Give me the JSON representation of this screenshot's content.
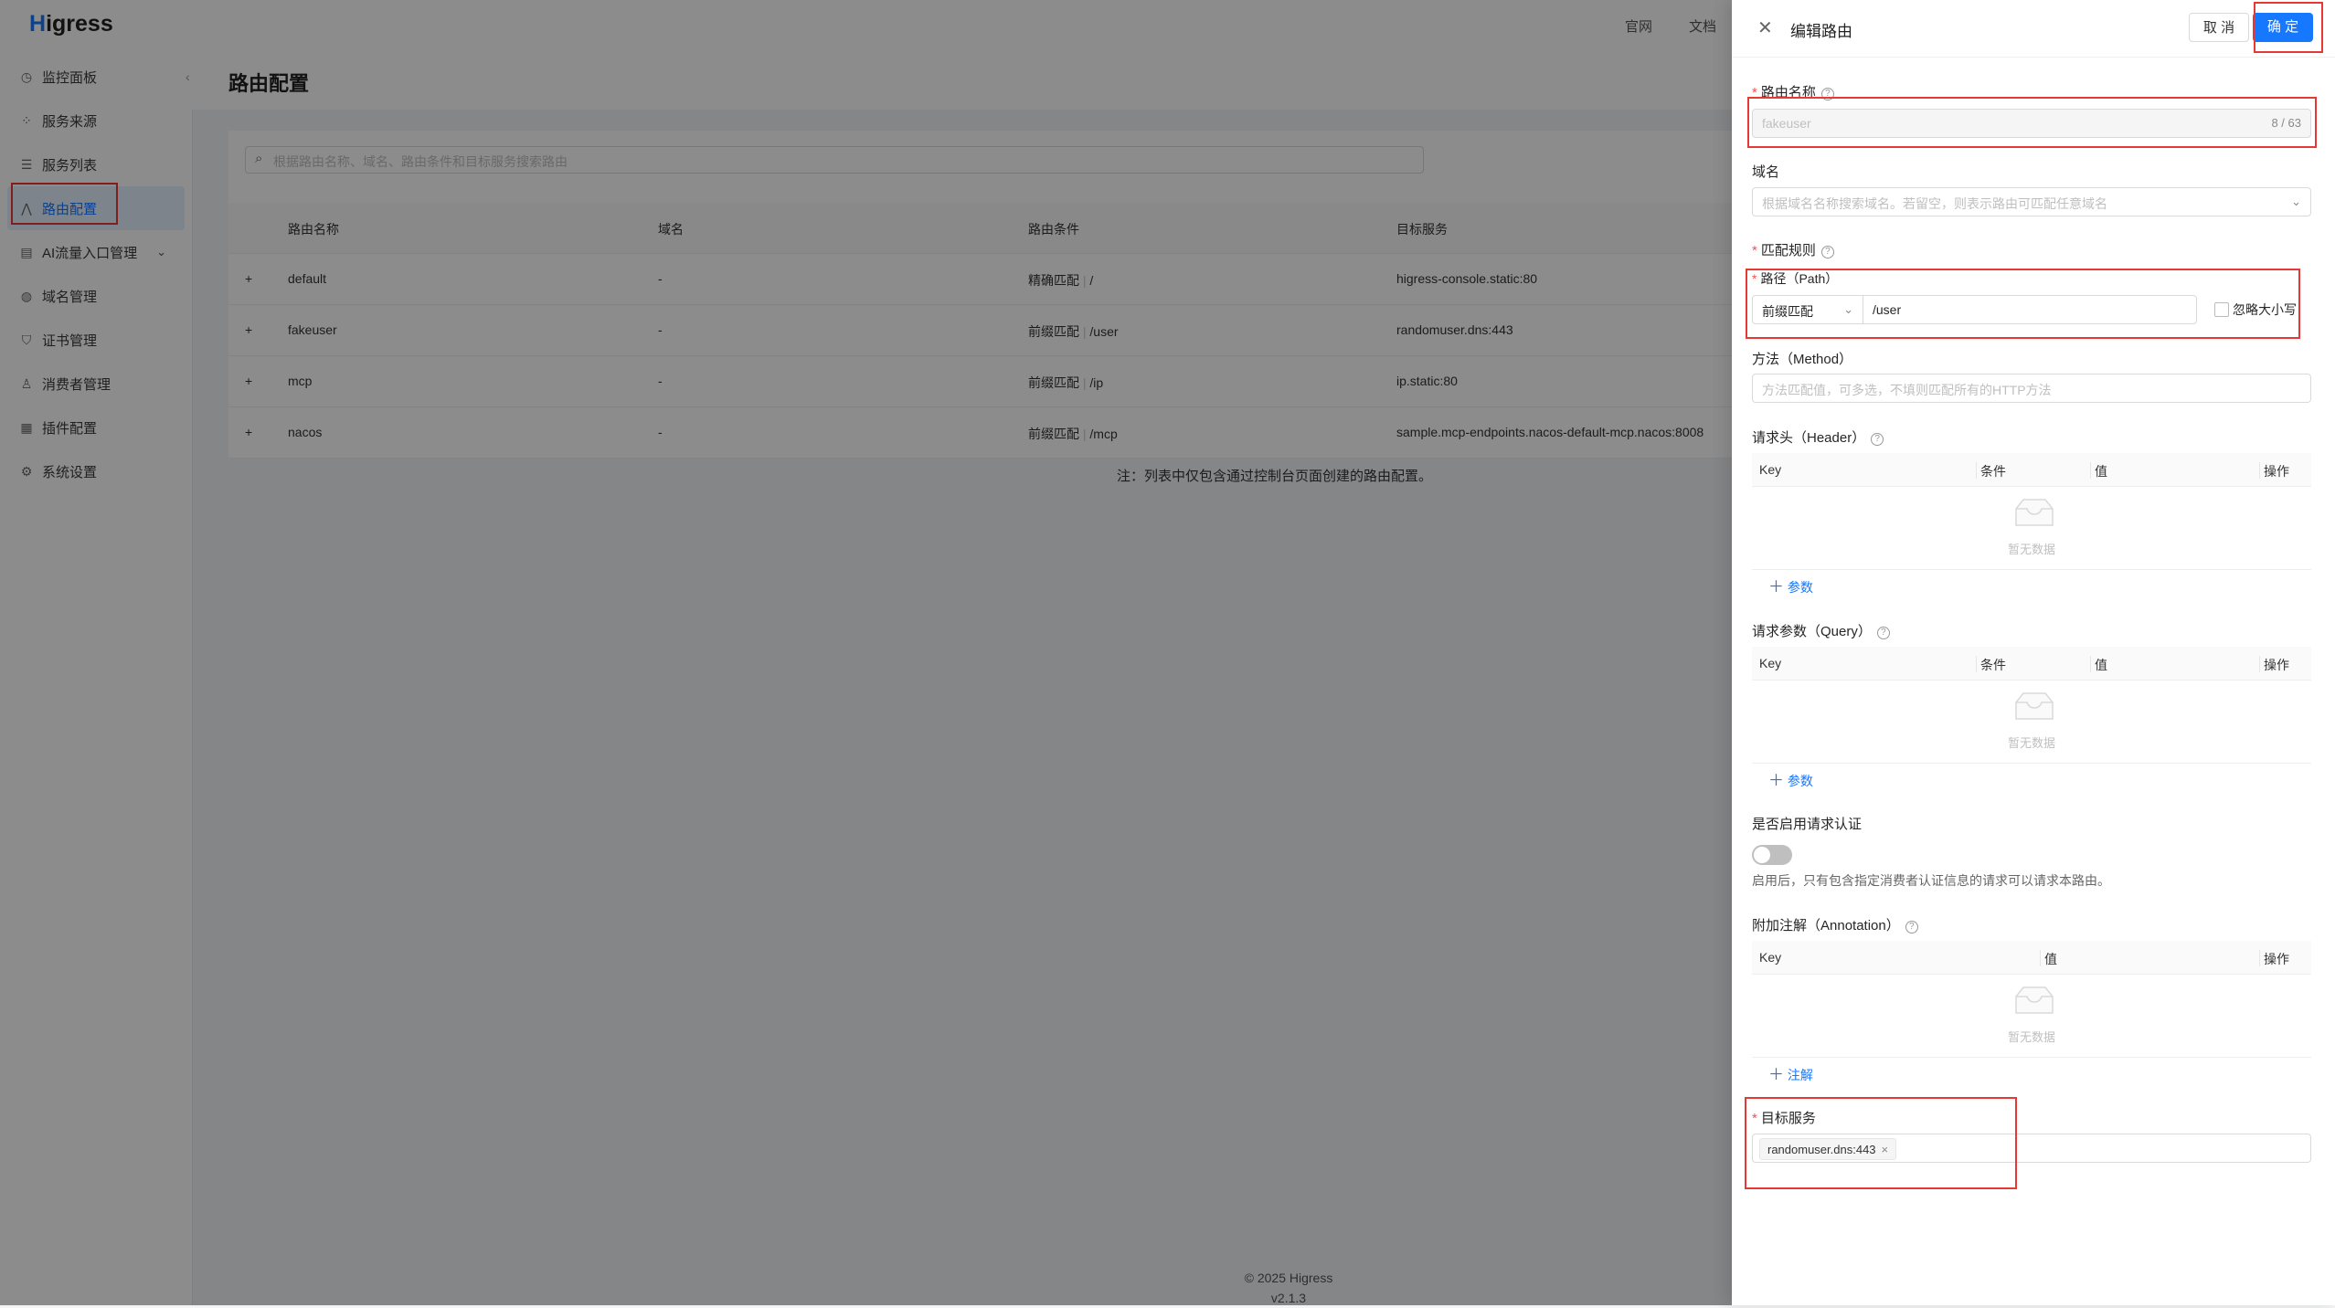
{
  "app": {
    "logo_first": "H",
    "logo_rest": "igress"
  },
  "sidebar": {
    "items": [
      {
        "label": "监控面板",
        "icon": "dashboard-icon"
      },
      {
        "label": "服务来源",
        "icon": "source-icon"
      },
      {
        "label": "服务列表",
        "icon": "list-icon"
      },
      {
        "label": "路由配置",
        "icon": "route-icon",
        "active": true
      },
      {
        "label": "AI流量入口管理",
        "icon": "ai-icon",
        "expandable": true
      },
      {
        "label": "域名管理",
        "icon": "globe-icon"
      },
      {
        "label": "证书管理",
        "icon": "shield-icon"
      },
      {
        "label": "消费者管理",
        "icon": "user-icon"
      },
      {
        "label": "插件配置",
        "icon": "plugin-icon"
      },
      {
        "label": "系统设置",
        "icon": "gear-icon"
      }
    ]
  },
  "header": {
    "links": [
      "官网",
      "文档"
    ]
  },
  "main": {
    "title": "路由配置",
    "search_placeholder": "根据路由名称、域名、路由条件和目标服务搜索路由",
    "columns": [
      "路由名称",
      "域名",
      "路由条件",
      "目标服务"
    ],
    "rows": [
      {
        "expand": "+",
        "name": "default",
        "domain": "-",
        "match": "精确匹配",
        "path": "/",
        "service": "higress-console.static:80"
      },
      {
        "expand": "+",
        "name": "fakeuser",
        "domain": "-",
        "match": "前缀匹配",
        "path": "/user",
        "service": "randomuser.dns:443"
      },
      {
        "expand": "+",
        "name": "mcp",
        "domain": "-",
        "match": "前缀匹配",
        "path": "/ip",
        "service": "ip.static:80"
      },
      {
        "expand": "+",
        "name": "nacos",
        "domain": "-",
        "match": "前缀匹配",
        "path": "/mcp",
        "service": "sample.mcp-endpoints.nacos-default-mcp.nacos:8008"
      }
    ],
    "note": "注：列表中仅包含通过控制台页面创建的路由配置。",
    "footer": {
      "copyright": "© 2025 Higress",
      "version": "v2.1.3"
    }
  },
  "drawer": {
    "title": "编辑路由",
    "cancel": "取 消",
    "ok": "确 定",
    "route_name": {
      "label": "路由名称",
      "value": "fakeuser",
      "count": "8 / 63"
    },
    "domain": {
      "label": "域名",
      "placeholder": "根据域名名称搜索域名。若留空，则表示路由可匹配任意域名"
    },
    "match_rule": {
      "label": "匹配规则"
    },
    "path": {
      "label": "路径（Path）",
      "match_type": "前缀匹配",
      "value": "/user",
      "ignore_case": "忽略大小写"
    },
    "method": {
      "label": "方法（Method）",
      "placeholder": "方法匹配值，可多选，不填则匹配所有的HTTP方法"
    },
    "header": {
      "label": "请求头（Header）",
      "cols": [
        "Key",
        "条件",
        "值",
        "操作"
      ],
      "empty": "暂无数据",
      "add": "参数"
    },
    "query": {
      "label": "请求参数（Query）",
      "cols": [
        "Key",
        "条件",
        "值",
        "操作"
      ],
      "empty": "暂无数据",
      "add": "参数"
    },
    "auth": {
      "label": "是否启用请求认证",
      "hint": "启用后，只有包含指定消费者认证信息的请求可以请求本路由。"
    },
    "annotation": {
      "label": "附加注解（Annotation）",
      "cols": [
        "Key",
        "值",
        "操作"
      ],
      "empty": "暂无数据",
      "add": "注解"
    },
    "target": {
      "label": "目标服务",
      "tag": "randomuser.dns:443"
    }
  }
}
